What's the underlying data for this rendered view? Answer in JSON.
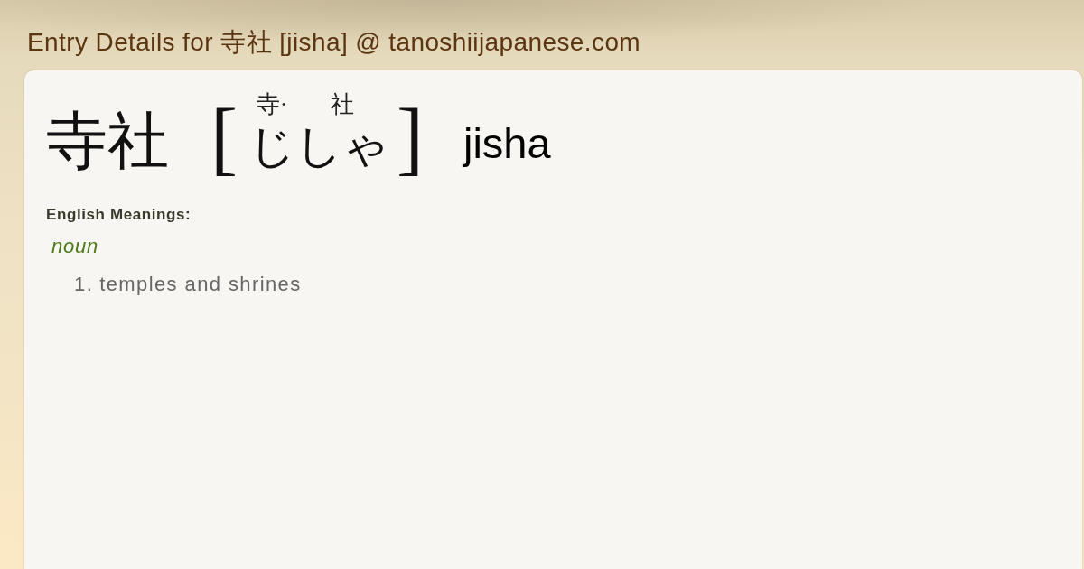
{
  "header": {
    "title": "Entry Details for 寺社 [jisha] @ tanoshiijapanese.com"
  },
  "entry": {
    "headword": "寺社",
    "reading": {
      "open_bracket": "[",
      "segments": [
        {
          "ruby": "寺·",
          "kana": "じ"
        },
        {
          "ruby": "社",
          "kana": "しゃ"
        }
      ],
      "close_bracket": "]"
    },
    "romaji": "jisha"
  },
  "meanings_heading": "English Meanings:",
  "senses": [
    {
      "part_of_speech": "noun",
      "definitions": [
        {
          "number": "1.",
          "text": "temples and shrines"
        }
      ]
    }
  ]
}
